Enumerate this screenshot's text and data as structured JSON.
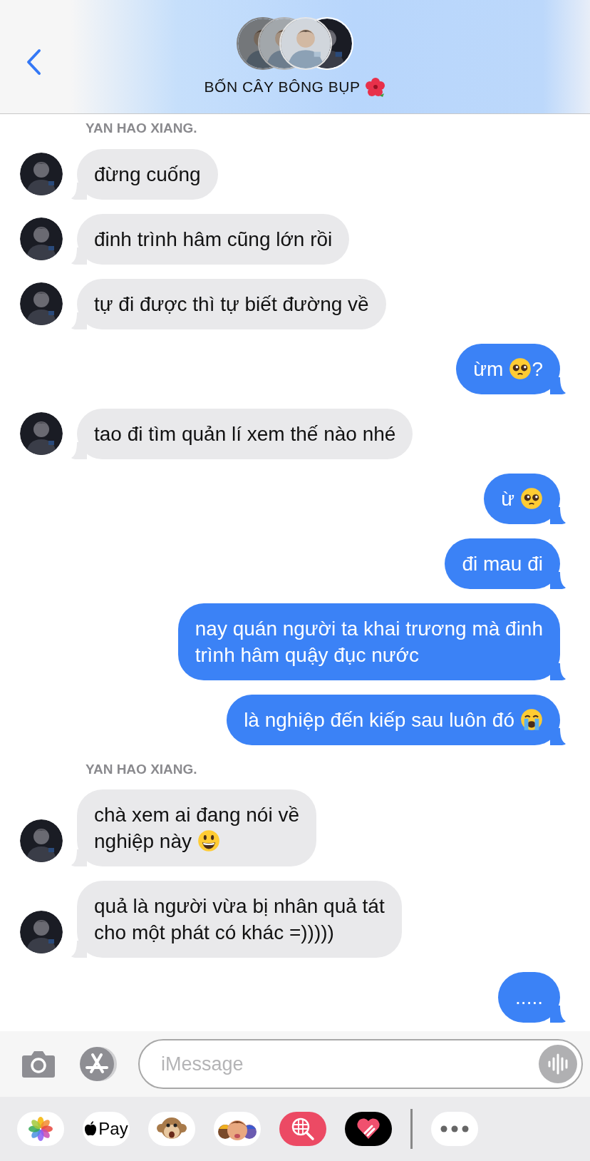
{
  "header": {
    "title": "BỐN CÂY BÔNG BỤP"
  },
  "messages": [
    {
      "kind": "label",
      "text": "YAN HAO XIANG."
    },
    {
      "kind": "received",
      "text": "đừng cuống"
    },
    {
      "kind": "received",
      "text": "đinh trình hâm cũng lớn rồi"
    },
    {
      "kind": "received",
      "text": "tự đi được thì tự biết đường về"
    },
    {
      "kind": "sent",
      "text": "ừm",
      "emoji": {
        "kind": "pleading"
      },
      "after": "?"
    },
    {
      "kind": "received",
      "text": "tao đi tìm quản lí xem thế nào nhé"
    },
    {
      "kind": "sent",
      "text": "ừ",
      "emoji": {
        "kind": "pleading"
      }
    },
    {
      "kind": "sent",
      "text": "đi mau đi"
    },
    {
      "kind": "sent",
      "text": "nay quán người ta khai trương mà đinh\ntrình hâm quậy đục nước"
    },
    {
      "kind": "sent",
      "text": "là nghiệp đến kiếp sau luôn đó",
      "emoji": {
        "kind": "crying"
      }
    },
    {
      "kind": "label",
      "text": "YAN HAO XIANG."
    },
    {
      "kind": "received",
      "text": "chà xem ai đang nói về\nnghiệp này",
      "emoji": {
        "kind": "grin"
      }
    },
    {
      "kind": "received",
      "text": "quả là người vừa bị nhân quả tát\ncho một phát có khác =)))))"
    },
    {
      "kind": "sent",
      "text": "....."
    }
  ],
  "composer": {
    "placeholder": "iMessage"
  },
  "apps": [
    {
      "kind": "photos"
    },
    {
      "kind": "pay",
      "text": "Pay"
    },
    {
      "kind": "monkey"
    },
    {
      "kind": "memoji"
    },
    {
      "kind": "search"
    },
    {
      "kind": "heart"
    },
    {
      "kind": "divider"
    },
    {
      "kind": "more"
    }
  ]
}
